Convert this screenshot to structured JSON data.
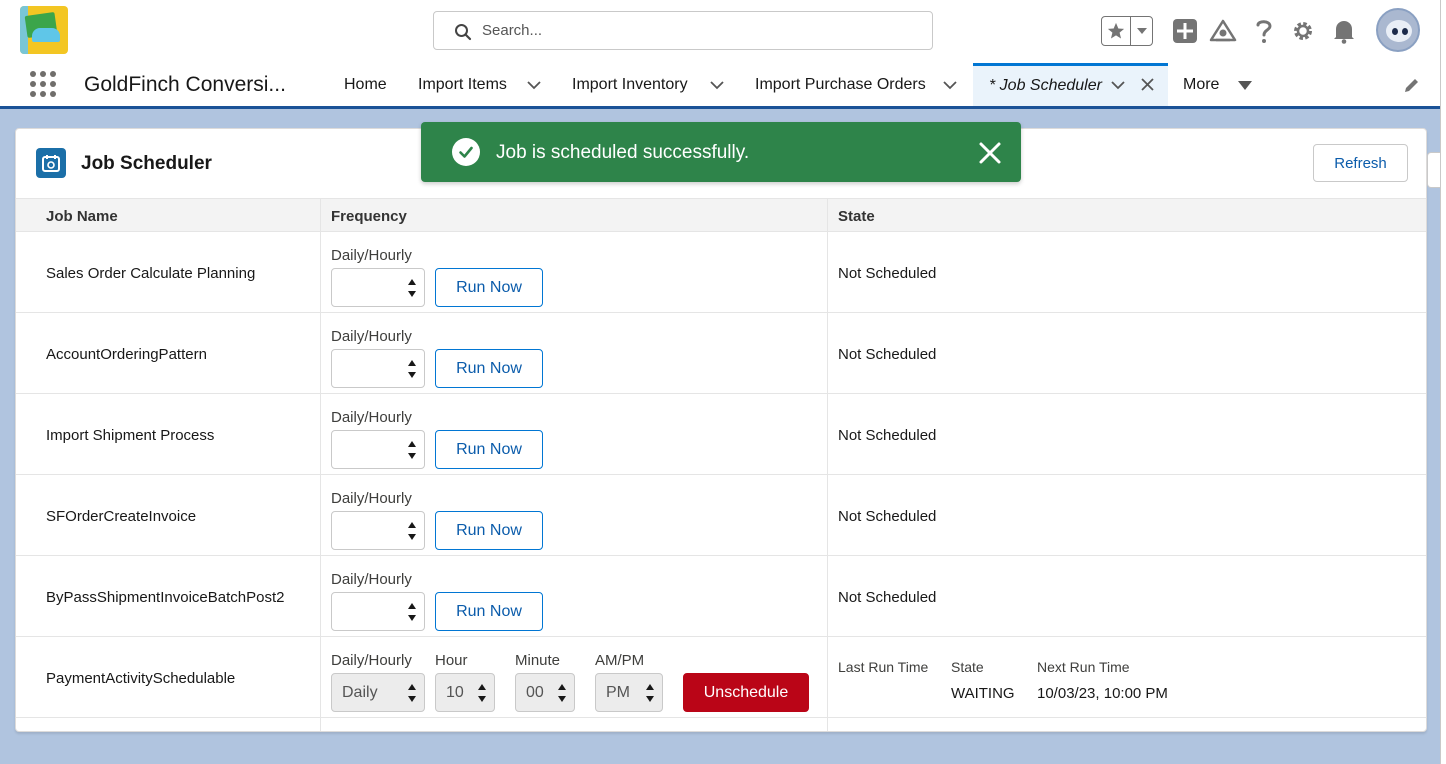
{
  "header": {
    "search_placeholder": "Search...",
    "icons": [
      "favorites-star-icon",
      "favorites-dropdown-icon",
      "global-actions-icon",
      "trailhead-icon",
      "help-icon",
      "setup-gear-icon",
      "notifications-bell-icon",
      "user-avatar"
    ]
  },
  "nav": {
    "app_name": "GoldFinch Conversi...",
    "items": [
      {
        "label": "Home"
      },
      {
        "label": "Import Items"
      },
      {
        "label": "Import Inventory"
      },
      {
        "label": "Import Purchase Orders"
      }
    ],
    "active_tab": "* Job Scheduler",
    "more_label": "More"
  },
  "toast": {
    "message": "Job is scheduled successfully.",
    "color": "#2e844a"
  },
  "card": {
    "title": "Job Scheduler",
    "refresh_label": "Refresh",
    "columns": [
      "Job Name",
      "Frequency",
      "State"
    ],
    "freq_label": "Daily/Hourly",
    "run_now_label": "Run Now",
    "rows": [
      {
        "name": "Sales Order Calculate Planning",
        "state": "Not Scheduled"
      },
      {
        "name": "AccountOrderingPattern",
        "state": "Not Scheduled"
      },
      {
        "name": "Import Shipment Process",
        "state": "Not Scheduled"
      },
      {
        "name": "SFOrderCreateInvoice",
        "state": "Not Scheduled"
      },
      {
        "name": "ByPassShipmentInvoiceBatchPost2",
        "state": "Not Scheduled"
      }
    ],
    "scheduled": {
      "name": "PaymentActivitySchedulable",
      "freq_label": "Daily/Hourly",
      "freq_value": "Daily",
      "hour_label": "Hour",
      "hour_value": "10",
      "minute_label": "Minute",
      "minute_value": "00",
      "ampm_label": "AM/PM",
      "ampm_value": "PM",
      "unschedule_label": "Unschedule",
      "last_run_label": "Last Run Time",
      "last_run_value": "",
      "state_label": "State",
      "state_value": "WAITING",
      "next_run_label": "Next Run Time",
      "next_run_value": "10/03/23, 10:00 PM"
    }
  },
  "colors": {
    "brand_blue": "#0176d3",
    "danger": "#ba0517",
    "background": "#b0c4df"
  }
}
